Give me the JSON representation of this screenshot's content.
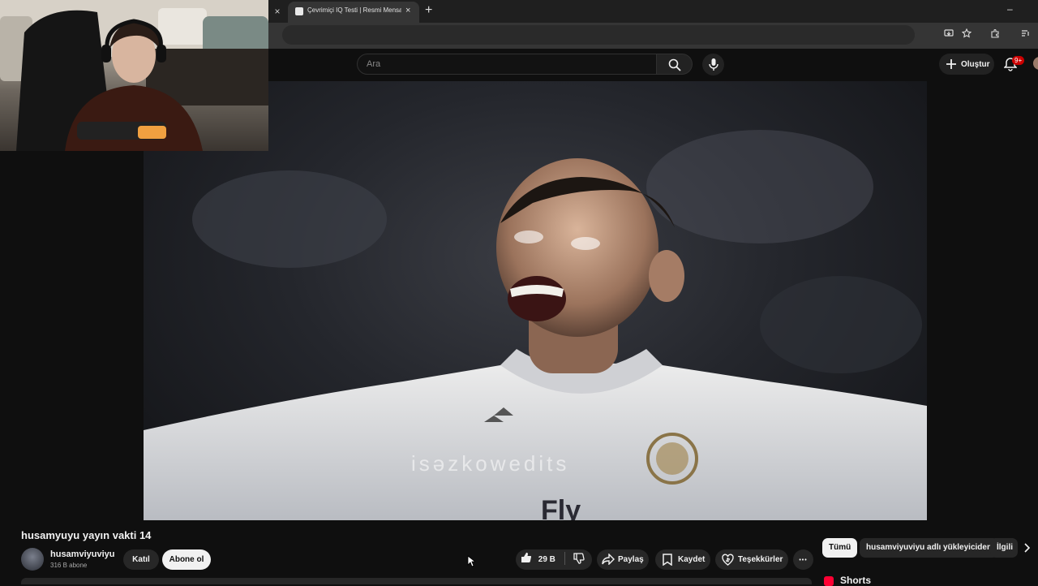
{
  "browser": {
    "tab_close_left": "×",
    "tab_title": "Çevrimiçi IQ Testi | Resmi Mensa",
    "tab_close": "×",
    "new_tab": "+",
    "window_minimize": "–"
  },
  "header": {
    "search_placeholder": "Ara",
    "create_label": "Oluştur",
    "notification_badge": "9+"
  },
  "video": {
    "title": "husamyuyu yayın vakti 14",
    "overlay_text": "isəzkowedits"
  },
  "channel": {
    "name": "husamviyuviyu",
    "subscribers": "316 B abone",
    "join_label": "Katıl",
    "subscribe_label": "Abone ol"
  },
  "actions": {
    "like_count": "29 B",
    "share_label": "Paylaş",
    "save_label": "Kaydet",
    "thanks_label": "Teşekkürler",
    "more_label": "•••"
  },
  "recommendations": {
    "chips": [
      "Tümü",
      "husamviyuviyu adlı yükleyiciden",
      "İlgili"
    ],
    "shorts_label": "Shorts"
  },
  "colors": {
    "background": "#0f0f0f",
    "chip": "#272727",
    "accent_red": "#ff0033",
    "text": "#f1f1f1"
  }
}
